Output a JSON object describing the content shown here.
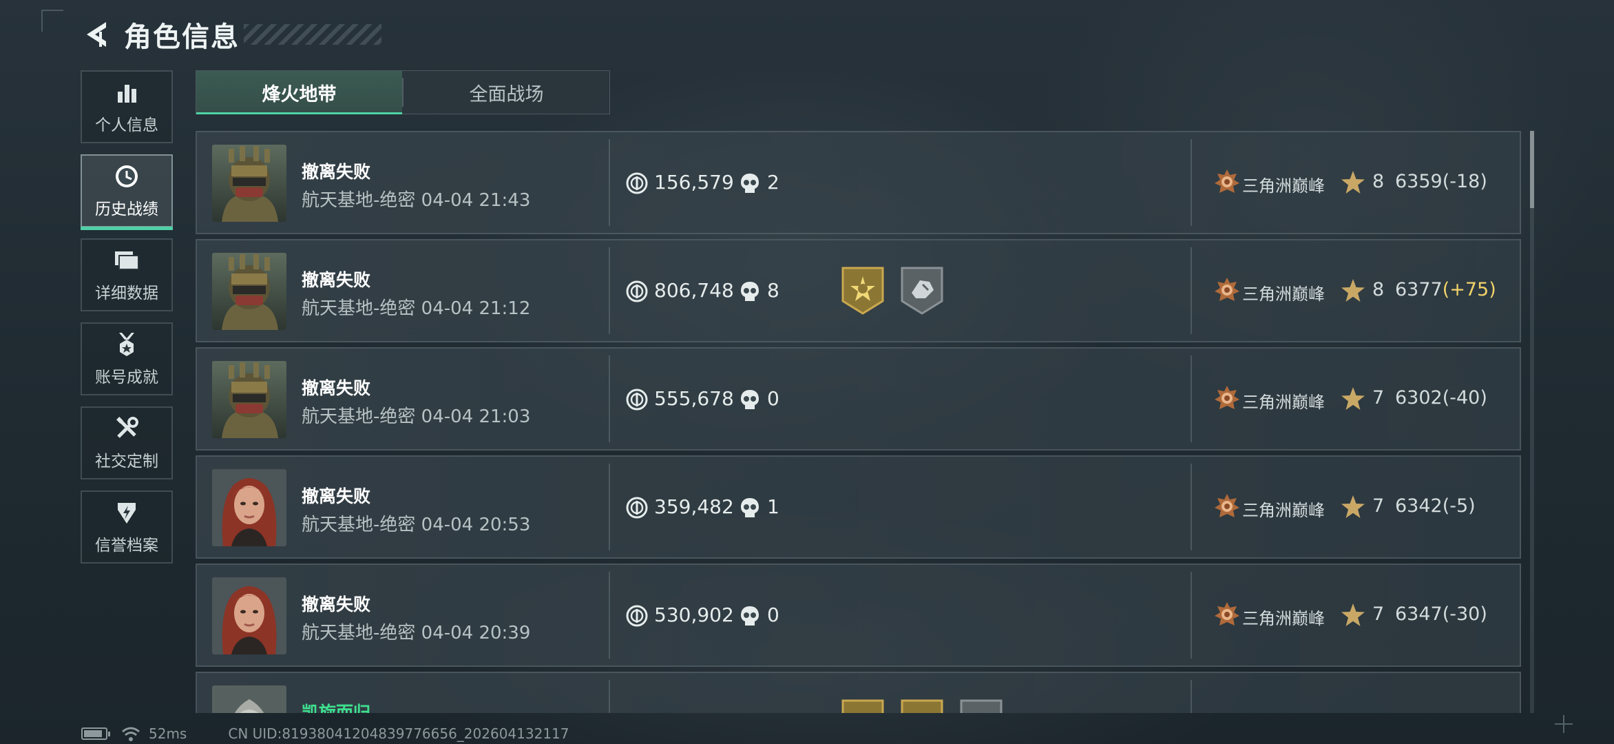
{
  "header": {
    "title": "角色信息"
  },
  "sidebar": {
    "items": [
      {
        "label": "个人信息",
        "icon": "bar-chart-icon"
      },
      {
        "label": "历史战绩",
        "icon": "clock-icon",
        "active": true
      },
      {
        "label": "详细数据",
        "icon": "folder-icon"
      },
      {
        "label": "账号成就",
        "icon": "medal-icon"
      },
      {
        "label": "社交定制",
        "icon": "tools-icon"
      },
      {
        "label": "信誉档案",
        "icon": "shield-icon"
      }
    ]
  },
  "tabs": [
    {
      "label": "烽火地带",
      "active": true
    },
    {
      "label": "全面战场",
      "active": false
    }
  ],
  "records": [
    {
      "result": "撤离失败",
      "map_time": "航天基地-绝密 04-04 21:43",
      "value": "156,579",
      "kills": "2",
      "rank": "三角洲巅峰",
      "level": "8",
      "score": "6359",
      "delta": "(-18)",
      "avatar": "soldier"
    },
    {
      "result": "撤离失败",
      "map_time": "航天基地-绝密 04-04 21:12",
      "value": "806,748",
      "kills": "8",
      "rank": "三角洲巅峰",
      "level": "8",
      "score": "6377",
      "delta": "(+75)",
      "avatar": "soldier",
      "badges": [
        "gold-star-badge-icon",
        "gray-hand-badge-icon"
      ]
    },
    {
      "result": "撤离失败",
      "map_time": "航天基地-绝密 04-04 21:03",
      "value": "555,678",
      "kills": "0",
      "rank": "三角洲巅峰",
      "level": "7",
      "score": "6302",
      "delta": "(-40)",
      "avatar": "soldier"
    },
    {
      "result": "撤离失败",
      "map_time": "航天基地-绝密 04-04 20:53",
      "value": "359,482",
      "kills": "1",
      "rank": "三角洲巅峰",
      "level": "7",
      "score": "6342",
      "delta": "(-5)",
      "avatar": "redhead"
    },
    {
      "result": "撤离失败",
      "map_time": "航天基地-绝密 04-04 20:39",
      "value": "530,902",
      "kills": "0",
      "rank": "三角洲巅峰",
      "level": "7",
      "score": "6347",
      "delta": "(-30)",
      "avatar": "redhead"
    },
    {
      "result": "凯旋而归",
      "avatar": "hooded",
      "badges": [
        "gold-badge-icon",
        "gold-badge-icon",
        "gray-badge-icon"
      ]
    }
  ],
  "status": {
    "ping": "52ms",
    "uid": "CN UID:8193804120483977665​6_202604132117"
  },
  "colors": {
    "accent": "#4fd1a6",
    "success": "#3ee08f",
    "positive_delta": "#f2d36b"
  }
}
